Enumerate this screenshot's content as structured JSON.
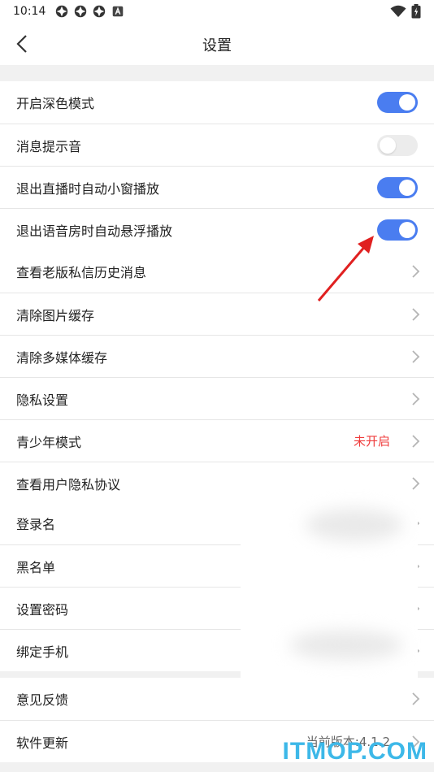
{
  "status_bar": {
    "time": "10:14",
    "notification_icons": [
      "app-icon",
      "app-icon",
      "app-icon",
      "a-icon"
    ],
    "right_icons": [
      "wifi-icon",
      "battery-icon"
    ]
  },
  "header": {
    "title": "设置"
  },
  "toggle_group": [
    {
      "label": "开启深色模式",
      "on": true
    },
    {
      "label": "消息提示音",
      "on": false
    },
    {
      "label": "退出直播时自动小窗播放",
      "on": true
    },
    {
      "label": "退出语音房时自动悬浮播放",
      "on": true
    }
  ],
  "nav_group": [
    {
      "label": "查看老版私信历史消息",
      "value": ""
    },
    {
      "label": "清除图片缓存",
      "value": ""
    },
    {
      "label": "清除多媒体缓存",
      "value": ""
    },
    {
      "label": "隐私设置",
      "value": ""
    },
    {
      "label": "青少年模式",
      "value": "未开启"
    },
    {
      "label": "查看用户隐私协议",
      "value": ""
    }
  ],
  "account_group": [
    {
      "label": "登录名"
    },
    {
      "label": "黑名单"
    },
    {
      "label": "设置密码"
    },
    {
      "label": "绑定手机"
    }
  ],
  "misc_group": [
    {
      "label": "意见反馈",
      "value": ""
    },
    {
      "label": "软件更新",
      "value": "当前版本:4.1.2"
    }
  ],
  "watermark": "ITMOP.COM",
  "colors": {
    "accent": "#4a7df0",
    "warning": "#ef3b3b",
    "watermark": "#3db8e8",
    "arrow": "#e02020"
  }
}
